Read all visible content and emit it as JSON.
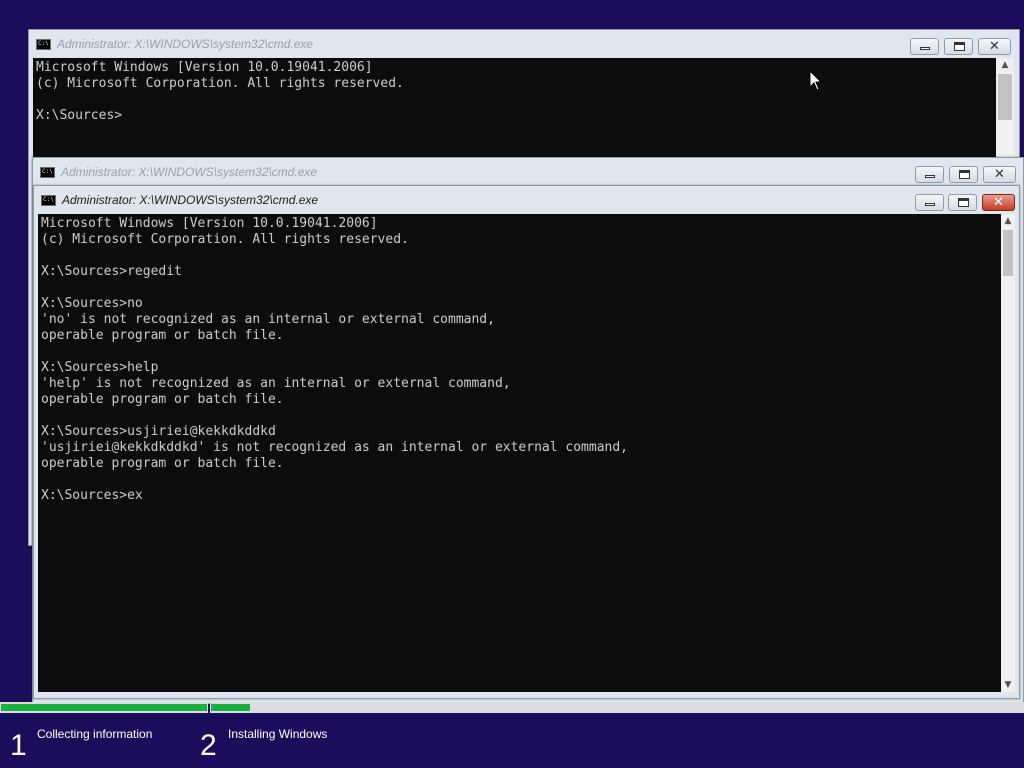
{
  "window_title": "Administrator: X:\\WINDOWS\\system32\\cmd.exe",
  "controls": {
    "minimize": "minimize",
    "maximize": "maximize",
    "close": "✕"
  },
  "window_back": {
    "lines": [
      "Microsoft Windows [Version 10.0.19041.2006]",
      "(c) Microsoft Corporation. All rights reserved.",
      "",
      "X:\\Sources>"
    ]
  },
  "window_middle": {
    "lines": []
  },
  "window_front": {
    "lines": [
      "Microsoft Windows [Version 10.0.19041.2006]",
      "(c) Microsoft Corporation. All rights reserved.",
      "",
      "X:\\Sources>regedit",
      "",
      "X:\\Sources>no",
      "'no' is not recognized as an internal or external command,",
      "operable program or batch file.",
      "",
      "X:\\Sources>help",
      "'help' is not recognized as an internal or external command,",
      "operable program or batch file.",
      "",
      "X:\\Sources>usjiriei@kekkdkddkd",
      "'usjiriei@kekkdkddkd' is not recognized as an internal or external command,",
      "operable program or batch file.",
      "",
      "X:\\Sources>ex"
    ]
  },
  "setup_steps": [
    {
      "number": "1",
      "label": "Collecting information",
      "progress": 1.0
    },
    {
      "number": "2",
      "label": "Installing Windows",
      "progress": 0.05
    }
  ],
  "icons": {
    "window": "cmd-icon",
    "cursor": "mouse-pointer-icon"
  },
  "colors": {
    "background": "#1c0d5c",
    "progress": "#19b040",
    "console_bg": "#0c0c0c",
    "console_text": "#cccccc",
    "close_button": "#c33c27"
  }
}
